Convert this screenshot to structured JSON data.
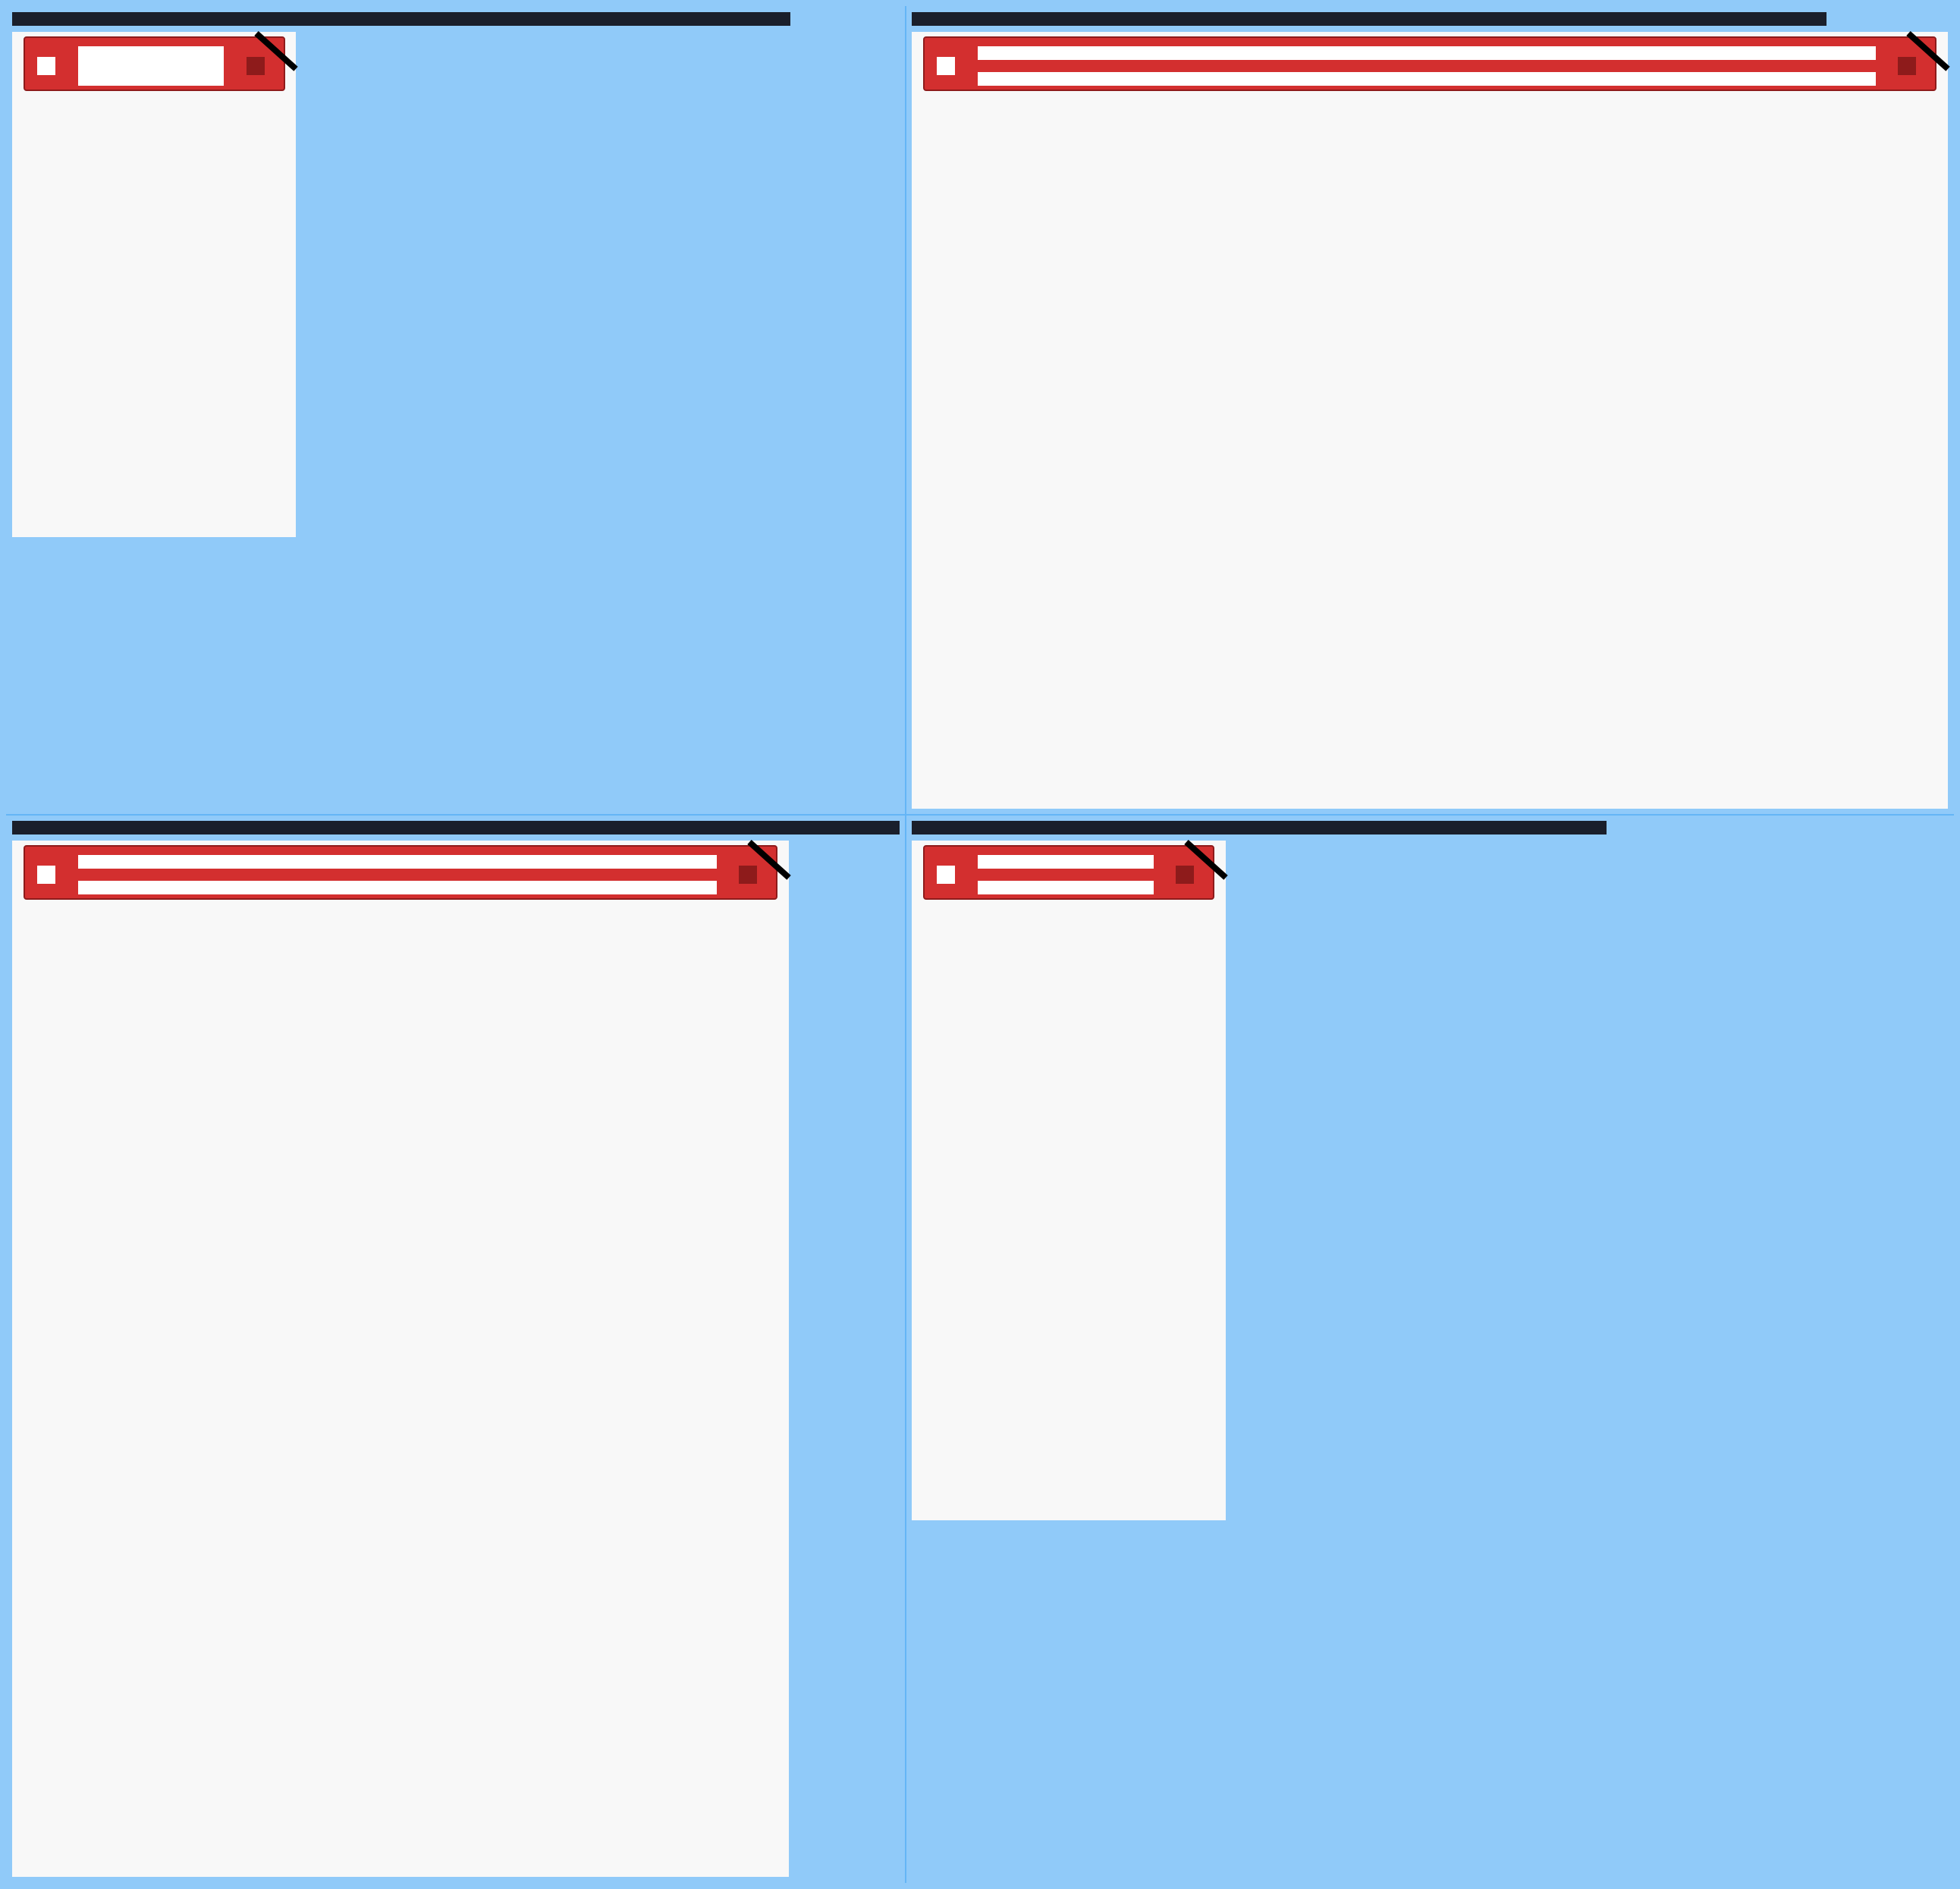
{
  "screen": {
    "background_color": "#90caf9",
    "divider_color": "#64b5f6"
  },
  "panes": [
    {
      "id": "top-left",
      "title_text": "",
      "toolbar": {
        "check_icon": "checkbox-icon",
        "field_value": "",
        "field_placeholder": "",
        "stop_icon": "stop-icon"
      }
    },
    {
      "id": "top-right",
      "title_text": "",
      "toolbar": {
        "check_icon": "checkbox-icon",
        "field_value": "",
        "field_placeholder": "",
        "stop_icon": "stop-icon"
      }
    },
    {
      "id": "bottom-left",
      "title_text": "",
      "toolbar": {
        "check_icon": "checkbox-icon",
        "field_value": "",
        "field_placeholder": "",
        "stop_icon": "stop-icon"
      }
    },
    {
      "id": "bottom-right",
      "title_text": "",
      "toolbar": {
        "check_icon": "checkbox-icon",
        "field_value": "",
        "field_placeholder": "",
        "stop_icon": "stop-icon"
      }
    }
  ],
  "colors": {
    "title_bar": "#1a1f2b",
    "window_body": "#f8f8f8",
    "toolbar": "#d32f2f",
    "toolbar_border": "#8e1b1b",
    "field": "#ffffff"
  }
}
